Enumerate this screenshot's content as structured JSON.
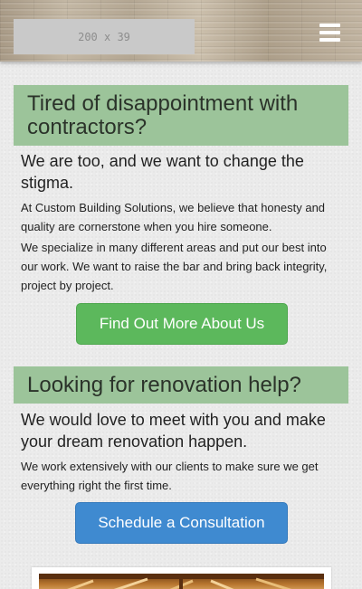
{
  "header": {
    "logo_placeholder": "200 x 39",
    "menu_icon": "hamburger-menu-icon"
  },
  "section1": {
    "heading": "Tired of disappointment with contractors?",
    "lead": "We are too, and we want to change the stigma.",
    "paragraphs": [
      "At Custom Building Solutions, we believe that honesty and quality are cornerstone when you hire someone.",
      "We specialize in many different areas and put our best into our work. We want to raise the bar and bring back integrity, project by project."
    ],
    "button_label": "Find Out More About Us"
  },
  "section2": {
    "heading": "Looking for renovation help?",
    "lead": "We would love to meet with you and make your dream renovation happen.",
    "paragraph": "We work extensively with our clients to make sure we get everything right the first time.",
    "button_label": "Schedule a Consultation"
  },
  "colors": {
    "heading_band": "#9cc49a",
    "primary_button": "#5cb85c",
    "secondary_button": "#3f8ad0"
  }
}
